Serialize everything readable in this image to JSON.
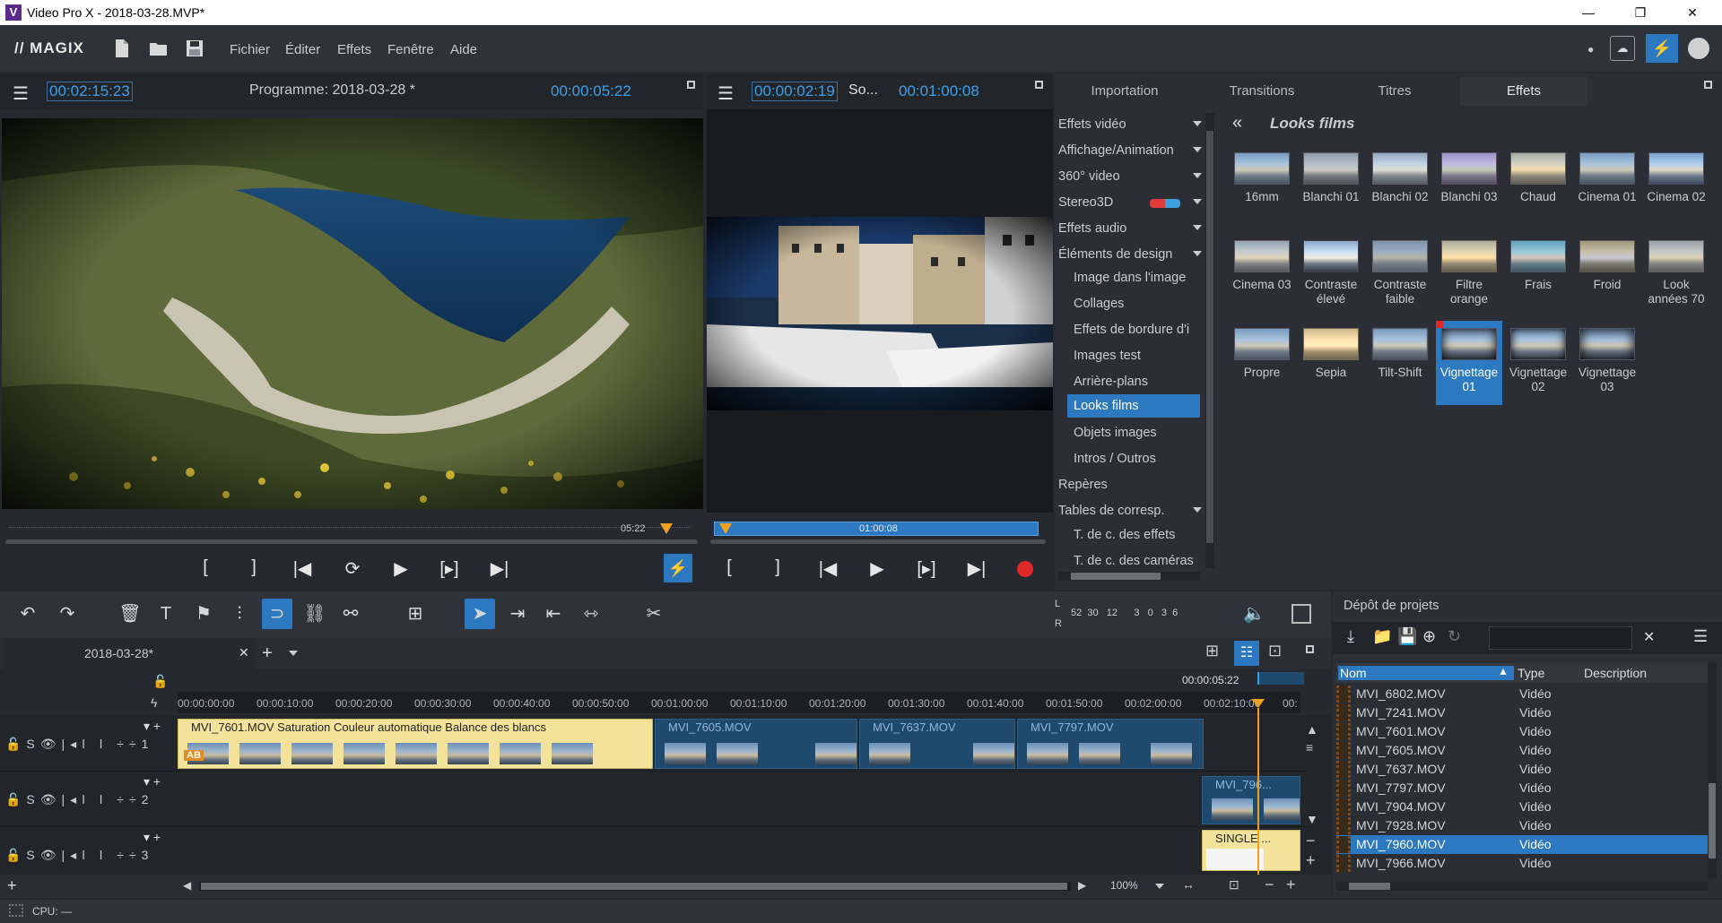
{
  "window": {
    "title": "Video Pro X - 2018-03-28.MVP*",
    "logo_letter": "V",
    "minimize": "—",
    "maximize": "❐",
    "close": "✕"
  },
  "menubar": {
    "brand": "// MAGIX",
    "items": [
      "Fichier",
      "Éditer",
      "Effets",
      "Fenêtre",
      "Aide"
    ]
  },
  "program_monitor": {
    "timecode_left": "00:02:15:23",
    "title": "Programme: 2018-03-28 *",
    "timecode_right": "00:00:05:22",
    "scrub_label": "05:22"
  },
  "source_monitor": {
    "timecode_left": "00:00:02:19",
    "title": "So...",
    "timecode_right": "00:01:00:08",
    "scrub_label": "01:00:08"
  },
  "media_tabs": [
    {
      "label": "Importation"
    },
    {
      "label": "Transitions"
    },
    {
      "label": "Titres"
    },
    {
      "label": "Effets"
    }
  ],
  "categories": [
    {
      "label": "Effets vidéo"
    },
    {
      "label": "Affichage/Animation"
    },
    {
      "label": "360° video"
    },
    {
      "label": "Stereo3D"
    },
    {
      "label": "Effets audio"
    },
    {
      "label": "Éléments de design"
    },
    {
      "label": "Image dans l'image"
    },
    {
      "label": "Collages"
    },
    {
      "label": "Effets de bordure d'i"
    },
    {
      "label": "Images test"
    },
    {
      "label": "Arrière-plans"
    },
    {
      "label": "Looks films"
    },
    {
      "label": "Objets images"
    },
    {
      "label": "Intros / Outros"
    },
    {
      "label": "Repères"
    },
    {
      "label": "Tables de corresp."
    },
    {
      "label": "T. de c. des effets"
    },
    {
      "label": "T. de c. des caméras"
    }
  ],
  "effects_panel": {
    "back": "«",
    "heading": "Looks films",
    "items": [
      {
        "label": "16mm"
      },
      {
        "label": "Blanchi 01"
      },
      {
        "label": "Blanchi 02"
      },
      {
        "label": "Blanchi 03"
      },
      {
        "label": "Chaud"
      },
      {
        "label": "Cinema 01"
      },
      {
        "label": "Cinema 02"
      },
      {
        "label": "Cinema 03"
      },
      {
        "label": "Contraste élevé"
      },
      {
        "label": "Contraste faible"
      },
      {
        "label": "Filtre orange"
      },
      {
        "label": "Frais"
      },
      {
        "label": "Froid"
      },
      {
        "label": "Look années 70"
      },
      {
        "label": "Propre"
      },
      {
        "label": "Sepia"
      },
      {
        "label": "Tilt-Shift"
      },
      {
        "label": "Vignettage 01"
      },
      {
        "label": "Vignettage 02"
      },
      {
        "label": "Vignettage 03"
      }
    ]
  },
  "meter": {
    "l": "L",
    "r": "R",
    "scale": "52  30   12      3   0   3  6"
  },
  "timeline": {
    "tab": "2018-03-28*",
    "position": "00:00:05:22",
    "ruler": [
      "00:00:00:00",
      "00:00:10:00",
      "00:00:20:00",
      "00:00:30:00",
      "00:00:40:00",
      "00:00:50:00",
      "00:01:00:00",
      "00:01:10:00",
      "00:01:20:00",
      "00:01:30:00",
      "00:01:40:00",
      "00:01:50:00",
      "00:02:00:00",
      "00:02:10:00",
      "00:"
    ],
    "clips": {
      "c1": "MVI_7601.MOV   Saturation   Couleur automatique   Balance des blancs",
      "c2": "MVI_7605.MOV",
      "c3": "MVI_7637.MOV",
      "c4": "MVI_7797.MOV",
      "c5": "MVI_796...",
      "c6": "SINGLE ..."
    },
    "track_labels": [
      "1",
      "2",
      "3"
    ],
    "ab_badge": "AB",
    "zoom": "100%"
  },
  "project_bin": {
    "title": "Dépôt de projets",
    "columns": {
      "name": "Nom",
      "type": "Type",
      "desc": "Description"
    },
    "rows": [
      {
        "name": "MVI_6802.MOV",
        "type": "Vidéo"
      },
      {
        "name": "MVI_7241.MOV",
        "type": "Vidéo"
      },
      {
        "name": "MVI_7601.MOV",
        "type": "Vidéo"
      },
      {
        "name": "MVI_7605.MOV",
        "type": "Vidéo"
      },
      {
        "name": "MVI_7637.MOV",
        "type": "Vidéo"
      },
      {
        "name": "MVI_7797.MOV",
        "type": "Vidéo"
      },
      {
        "name": "MVI_7904.MOV",
        "type": "Vidéo"
      },
      {
        "name": "MVI_7928.MOV",
        "type": "Vidéo"
      },
      {
        "name": "MVI_7960.MOV",
        "type": "Vidéo"
      },
      {
        "name": "MVI_7966.MOV",
        "type": "Vidéo"
      }
    ]
  },
  "statusbar": {
    "cpu": "CPU: —"
  },
  "colors": {
    "accent": "#2c79c1",
    "timecode": "#3d9ee8",
    "clip_yellow": "#f3e39a",
    "clip_blue": "#1f4a6e"
  }
}
